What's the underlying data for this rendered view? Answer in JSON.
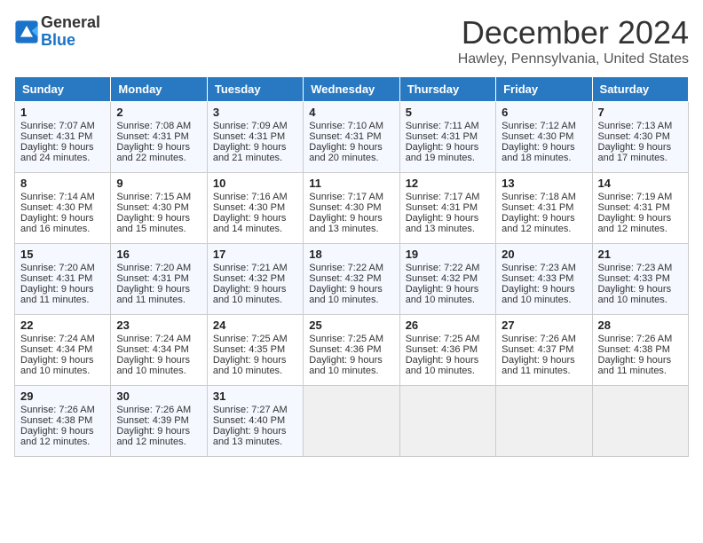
{
  "header": {
    "logo_general": "General",
    "logo_blue": "Blue",
    "month_title": "December 2024",
    "location": "Hawley, Pennsylvania, United States"
  },
  "days_of_week": [
    "Sunday",
    "Monday",
    "Tuesday",
    "Wednesday",
    "Thursday",
    "Friday",
    "Saturday"
  ],
  "weeks": [
    [
      {
        "day": "1",
        "sunrise": "Sunrise: 7:07 AM",
        "sunset": "Sunset: 4:31 PM",
        "daylight": "Daylight: 9 hours and 24 minutes."
      },
      {
        "day": "2",
        "sunrise": "Sunrise: 7:08 AM",
        "sunset": "Sunset: 4:31 PM",
        "daylight": "Daylight: 9 hours and 22 minutes."
      },
      {
        "day": "3",
        "sunrise": "Sunrise: 7:09 AM",
        "sunset": "Sunset: 4:31 PM",
        "daylight": "Daylight: 9 hours and 21 minutes."
      },
      {
        "day": "4",
        "sunrise": "Sunrise: 7:10 AM",
        "sunset": "Sunset: 4:31 PM",
        "daylight": "Daylight: 9 hours and 20 minutes."
      },
      {
        "day": "5",
        "sunrise": "Sunrise: 7:11 AM",
        "sunset": "Sunset: 4:31 PM",
        "daylight": "Daylight: 9 hours and 19 minutes."
      },
      {
        "day": "6",
        "sunrise": "Sunrise: 7:12 AM",
        "sunset": "Sunset: 4:30 PM",
        "daylight": "Daylight: 9 hours and 18 minutes."
      },
      {
        "day": "7",
        "sunrise": "Sunrise: 7:13 AM",
        "sunset": "Sunset: 4:30 PM",
        "daylight": "Daylight: 9 hours and 17 minutes."
      }
    ],
    [
      {
        "day": "8",
        "sunrise": "Sunrise: 7:14 AM",
        "sunset": "Sunset: 4:30 PM",
        "daylight": "Daylight: 9 hours and 16 minutes."
      },
      {
        "day": "9",
        "sunrise": "Sunrise: 7:15 AM",
        "sunset": "Sunset: 4:30 PM",
        "daylight": "Daylight: 9 hours and 15 minutes."
      },
      {
        "day": "10",
        "sunrise": "Sunrise: 7:16 AM",
        "sunset": "Sunset: 4:30 PM",
        "daylight": "Daylight: 9 hours and 14 minutes."
      },
      {
        "day": "11",
        "sunrise": "Sunrise: 7:17 AM",
        "sunset": "Sunset: 4:30 PM",
        "daylight": "Daylight: 9 hours and 13 minutes."
      },
      {
        "day": "12",
        "sunrise": "Sunrise: 7:17 AM",
        "sunset": "Sunset: 4:31 PM",
        "daylight": "Daylight: 9 hours and 13 minutes."
      },
      {
        "day": "13",
        "sunrise": "Sunrise: 7:18 AM",
        "sunset": "Sunset: 4:31 PM",
        "daylight": "Daylight: 9 hours and 12 minutes."
      },
      {
        "day": "14",
        "sunrise": "Sunrise: 7:19 AM",
        "sunset": "Sunset: 4:31 PM",
        "daylight": "Daylight: 9 hours and 12 minutes."
      }
    ],
    [
      {
        "day": "15",
        "sunrise": "Sunrise: 7:20 AM",
        "sunset": "Sunset: 4:31 PM",
        "daylight": "Daylight: 9 hours and 11 minutes."
      },
      {
        "day": "16",
        "sunrise": "Sunrise: 7:20 AM",
        "sunset": "Sunset: 4:31 PM",
        "daylight": "Daylight: 9 hours and 11 minutes."
      },
      {
        "day": "17",
        "sunrise": "Sunrise: 7:21 AM",
        "sunset": "Sunset: 4:32 PM",
        "daylight": "Daylight: 9 hours and 10 minutes."
      },
      {
        "day": "18",
        "sunrise": "Sunrise: 7:22 AM",
        "sunset": "Sunset: 4:32 PM",
        "daylight": "Daylight: 9 hours and 10 minutes."
      },
      {
        "day": "19",
        "sunrise": "Sunrise: 7:22 AM",
        "sunset": "Sunset: 4:32 PM",
        "daylight": "Daylight: 9 hours and 10 minutes."
      },
      {
        "day": "20",
        "sunrise": "Sunrise: 7:23 AM",
        "sunset": "Sunset: 4:33 PM",
        "daylight": "Daylight: 9 hours and 10 minutes."
      },
      {
        "day": "21",
        "sunrise": "Sunrise: 7:23 AM",
        "sunset": "Sunset: 4:33 PM",
        "daylight": "Daylight: 9 hours and 10 minutes."
      }
    ],
    [
      {
        "day": "22",
        "sunrise": "Sunrise: 7:24 AM",
        "sunset": "Sunset: 4:34 PM",
        "daylight": "Daylight: 9 hours and 10 minutes."
      },
      {
        "day": "23",
        "sunrise": "Sunrise: 7:24 AM",
        "sunset": "Sunset: 4:34 PM",
        "daylight": "Daylight: 9 hours and 10 minutes."
      },
      {
        "day": "24",
        "sunrise": "Sunrise: 7:25 AM",
        "sunset": "Sunset: 4:35 PM",
        "daylight": "Daylight: 9 hours and 10 minutes."
      },
      {
        "day": "25",
        "sunrise": "Sunrise: 7:25 AM",
        "sunset": "Sunset: 4:36 PM",
        "daylight": "Daylight: 9 hours and 10 minutes."
      },
      {
        "day": "26",
        "sunrise": "Sunrise: 7:25 AM",
        "sunset": "Sunset: 4:36 PM",
        "daylight": "Daylight: 9 hours and 10 minutes."
      },
      {
        "day": "27",
        "sunrise": "Sunrise: 7:26 AM",
        "sunset": "Sunset: 4:37 PM",
        "daylight": "Daylight: 9 hours and 11 minutes."
      },
      {
        "day": "28",
        "sunrise": "Sunrise: 7:26 AM",
        "sunset": "Sunset: 4:38 PM",
        "daylight": "Daylight: 9 hours and 11 minutes."
      }
    ],
    [
      {
        "day": "29",
        "sunrise": "Sunrise: 7:26 AM",
        "sunset": "Sunset: 4:38 PM",
        "daylight": "Daylight: 9 hours and 12 minutes."
      },
      {
        "day": "30",
        "sunrise": "Sunrise: 7:26 AM",
        "sunset": "Sunset: 4:39 PM",
        "daylight": "Daylight: 9 hours and 12 minutes."
      },
      {
        "day": "31",
        "sunrise": "Sunrise: 7:27 AM",
        "sunset": "Sunset: 4:40 PM",
        "daylight": "Daylight: 9 hours and 13 minutes."
      },
      null,
      null,
      null,
      null
    ]
  ]
}
